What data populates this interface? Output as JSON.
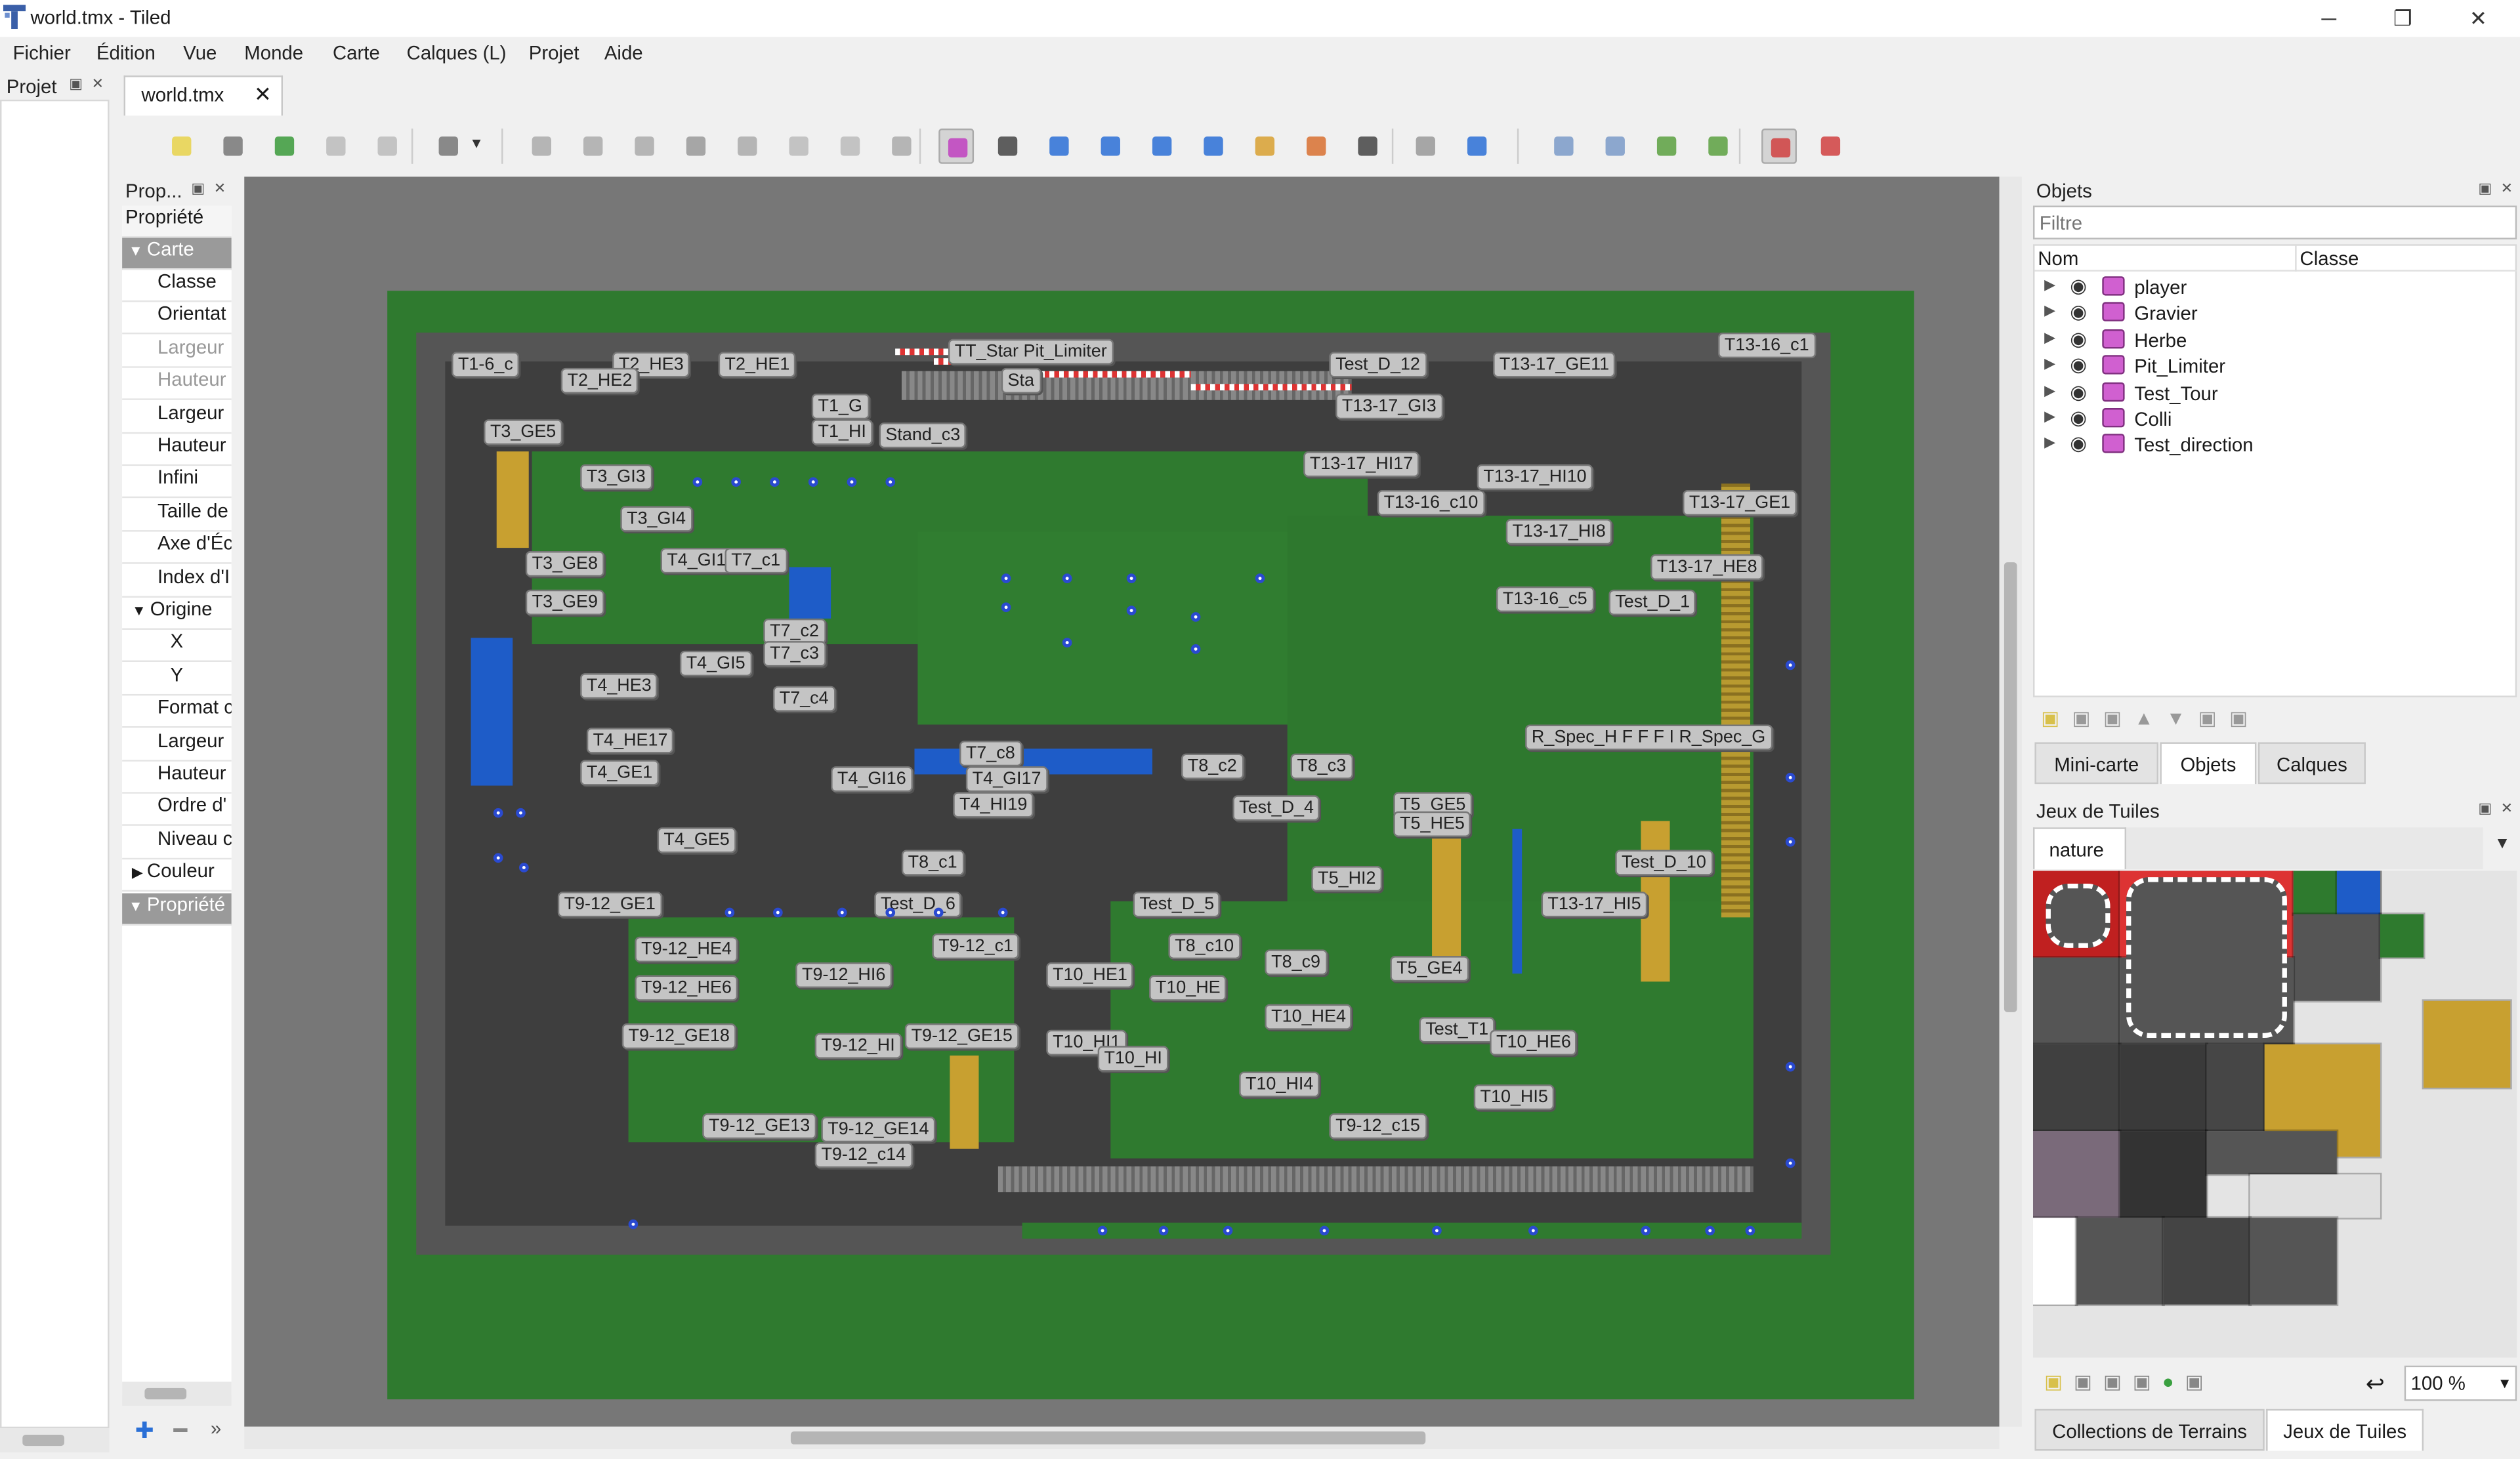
{
  "window": {
    "title": "world.tmx - Tiled",
    "minimize": "─",
    "maximize": "❐",
    "close": "✕"
  },
  "menu": [
    "Fichier",
    "Édition",
    "Vue",
    "Monde",
    "Carte",
    "Calques (L)",
    "Projet",
    "Aide"
  ],
  "project_dock": {
    "title": "Projet"
  },
  "document_tab": {
    "label": "world.tmx",
    "close": "✕"
  },
  "properties": {
    "title": "Prop...",
    "header": "Propriété",
    "group_map": "Carte",
    "rows": [
      "Classe",
      "Orientat",
      "Largeur",
      "Hauteur",
      "Largeur",
      "Hauteur",
      "Infini",
      "Taille de",
      "Axe d'Éc",
      "Index d'I",
      "Origine",
      "X",
      "Y",
      "Format c",
      "Largeur",
      "Hauteur",
      "Ordre d'",
      "Niveau c",
      "Couleur",
      "Propriété"
    ]
  },
  "map_labels": [
    "T1-6_c",
    "T2_HE3",
    "T2_HE2",
    "T2_HE1",
    "T3_GE5",
    "T3_GI3",
    "T3_GI4",
    "T3_GE8",
    "T3_GE9",
    "T4_GI1",
    "T7_c1",
    "T1_G",
    "T1_HI",
    "Stand_c3",
    "TT_Star Pit_Limiter",
    "Sta",
    "Test_D_12",
    "T13-16_c1",
    "T13-17_GE11",
    "T13-17_GI3",
    "T13-17_HI17",
    "T13-16_c10",
    "T13-17_HI10",
    "T13-17_GE1",
    "T13-17_HI8",
    "T13-17_HE8",
    "T13-16_c5",
    "Test_D_1",
    "T4_HE3",
    "T4_GI5",
    "T7_c2",
    "T7_c3",
    "T7_c4",
    "T4_HE17",
    "T4_GE1",
    "T4_GE5",
    "T4_GI16",
    "T7_c8",
    "T4_GI17",
    "T4_HI19",
    "T8_c2",
    "T8_c3",
    "Test_D_4",
    "T5_GE5",
    "T5_HE5",
    "R_Spec_H F F F I R_Spec_G",
    "T8_c1",
    "T9-12_GE1",
    "Test_D_6",
    "Test_D_5",
    "T5_HI2",
    "Test_D_10",
    "T13-17_HI5",
    "T9-12_HE4",
    "T9-12_c1",
    "T8_c10",
    "T9-12_HI6",
    "T10_HE1",
    "T8_c9",
    "T5_GE4",
    "T9-12_HE6",
    "T10_HE",
    "T10_HE4",
    "Test_T1",
    "T10_HE6",
    "T9-12_GE18",
    "T9-12_GE15",
    "T10_HI1",
    "T9-12_HI",
    "T10_HI",
    "T10_HI4",
    "T10_HI5",
    "T9-12_GE13",
    "T9-12_GE14",
    "T9-12_c14",
    "T9-12_c15"
  ],
  "objects_panel": {
    "title": "Objets",
    "filter_placeholder": "Filtre",
    "col_name": "Nom",
    "col_class": "Classe",
    "layers": [
      "player",
      "Gravier",
      "Herbe",
      "Pit_Limiter",
      "Test_Tour",
      "Colli",
      "Test_direction"
    ]
  },
  "bottom_tabs": [
    "Mini-carte",
    "Objets",
    "Calques"
  ],
  "tilesets_panel": {
    "title": "Jeux de Tuiles",
    "tileset": "nature",
    "zoom": "100 %"
  },
  "footer_tabs": [
    "Collections de Terrains",
    "Jeux de Tuiles"
  ],
  "colors": {
    "map_green": "#2f7a2f",
    "road": "#4a4a4a",
    "label": "#c4c4c4",
    "layer_icon": "#c040c0"
  }
}
